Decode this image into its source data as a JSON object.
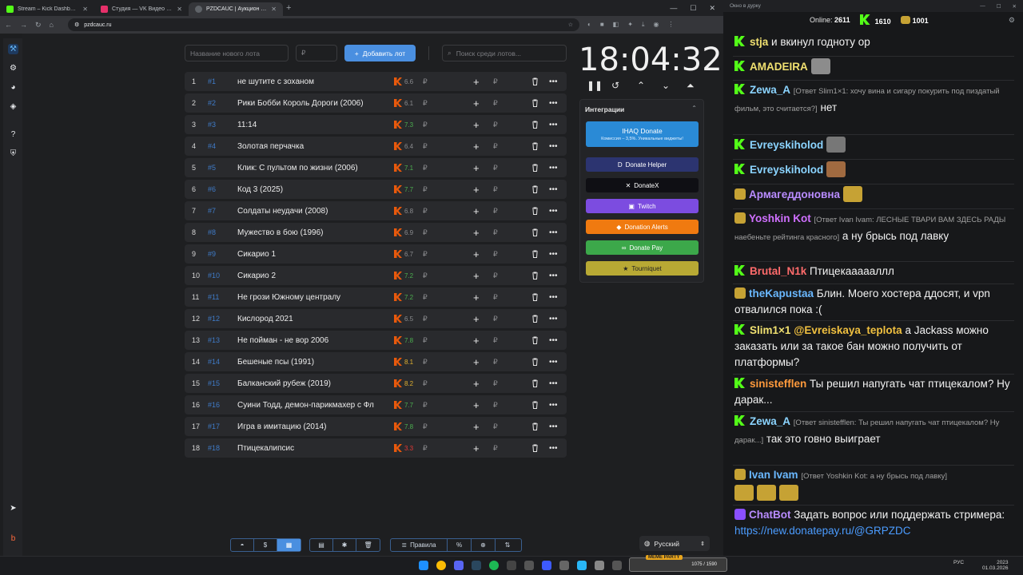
{
  "browser": {
    "tabs": [
      {
        "title": "Stream – Kick Dashboard",
        "color": "#53fc18"
      },
      {
        "title": "Студия — VK Видео Live",
        "color": "#e6306a"
      },
      {
        "title": "PZDCAUC | Аукцион для стри...",
        "color": "#9aa0a6"
      }
    ],
    "url": "pzdcauc.ru"
  },
  "lot_form": {
    "name_placeholder": "Название нового лота",
    "price_placeholder": "₽",
    "add_label": "Добавить лот",
    "search_placeholder": "Поиск среди лотов..."
  },
  "lots": [
    {
      "n": "1",
      "id": "#1",
      "title": "не шутите с зоханом",
      "kp": "6.6",
      "kp_color": "#8a8b8e"
    },
    {
      "n": "2",
      "id": "#2",
      "title": "Рики Бобби Король Дороги (2006)",
      "kp": "6.1",
      "kp_color": "#8a8b8e"
    },
    {
      "n": "3",
      "id": "#3",
      "title": "11:14",
      "kp": "7.3",
      "kp_color": "#4caf50"
    },
    {
      "n": "4",
      "id": "#4",
      "title": "Золотая перчачка",
      "kp": "6.4",
      "kp_color": "#8a8b8e"
    },
    {
      "n": "5",
      "id": "#5",
      "title": "Клик: С пультом по жизни (2006)",
      "kp": "7.1",
      "kp_color": "#4caf50"
    },
    {
      "n": "6",
      "id": "#6",
      "title": "Код 3 (2025)",
      "kp": "7.7",
      "kp_color": "#4caf50"
    },
    {
      "n": "7",
      "id": "#7",
      "title": "Солдаты неудачи (2008)",
      "kp": "6.8",
      "kp_color": "#8a8b8e"
    },
    {
      "n": "8",
      "id": "#8",
      "title": "Мужество в бою (1996)",
      "kp": "6.9",
      "kp_color": "#8a8b8e"
    },
    {
      "n": "9",
      "id": "#9",
      "title": "Сикарио 1",
      "kp": "6.7",
      "kp_color": "#8a8b8e"
    },
    {
      "n": "10",
      "id": "#10",
      "title": "Сикарио 2",
      "kp": "7.2",
      "kp_color": "#4caf50"
    },
    {
      "n": "11",
      "id": "#11",
      "title": "Не грози Южному централу",
      "kp": "7.2",
      "kp_color": "#4caf50"
    },
    {
      "n": "12",
      "id": "#12",
      "title": "Кислород 2021",
      "kp": "6.5",
      "kp_color": "#8a8b8e"
    },
    {
      "n": "13",
      "id": "#13",
      "title": "Не пойман - не вор 2006",
      "kp": "7.8",
      "kp_color": "#4caf50"
    },
    {
      "n": "14",
      "id": "#14",
      "title": "Бешеные псы (1991)",
      "kp": "8.1",
      "kp_color": "#e0b030"
    },
    {
      "n": "15",
      "id": "#15",
      "title": "Балканский рубеж (2019)",
      "kp": "8.2",
      "kp_color": "#e0b030"
    },
    {
      "n": "16",
      "id": "#16",
      "title": "Суини Тодд, демон-парикмахер с Фл",
      "kp": "7.7",
      "kp_color": "#4caf50"
    },
    {
      "n": "17",
      "id": "#17",
      "title": "Игра в имитацию (2014)",
      "kp": "7.8",
      "kp_color": "#4caf50"
    },
    {
      "n": "18",
      "id": "#18",
      "title": "Птицекалипсис",
      "kp": "3.3",
      "kp_color": "#e53935"
    }
  ],
  "currency": "₽",
  "timer": "18:04:32",
  "integrations": {
    "title": "Интеграции",
    "ihaq_title": "IHAQ Donate",
    "ihaq_sub": "Комиссия – 3,5%. Уникальные виджеты!",
    "buttons": [
      {
        "label": "Donate Helper",
        "bg": "#2c3470",
        "icon": "D"
      },
      {
        "label": "DonateX",
        "bg": "#0f0f14",
        "icon": "✕"
      },
      {
        "label": "Twitch",
        "bg": "#7c4ce0",
        "icon": "▣"
      },
      {
        "label": "Donation Alerts",
        "bg": "#f07a10",
        "icon": "◆"
      },
      {
        "label": "Donate Pay",
        "bg": "#3ca84a",
        "icon": "∞"
      },
      {
        "label": "Tourniquet",
        "bg": "#b8a934",
        "icon": "★"
      }
    ]
  },
  "toolbar": {
    "rules": "Правила",
    "percent": "%"
  },
  "language": "Русский",
  "chat": {
    "window_title": "Окно в дурку",
    "online_label": "Online:",
    "online": "2611",
    "kick_count": "1610",
    "vk_count": "1001",
    "messages": [
      {
        "user": "stja",
        "color": "#f0e070",
        "text": "и вкинул годноту ор"
      },
      {
        "user": "AMADEIRA",
        "color": "#f0e070",
        "text": ""
      },
      {
        "user": "Zewa_A",
        "color": "#8bd4ff",
        "reply": "[Ответ Slim1×1: хочу вина и сигару покурить под пиздатый фильм, это считается?]",
        "text": "нет"
      },
      {
        "user": "Evreyskiholod",
        "color": "#8bd4ff",
        "text": ""
      },
      {
        "user": "Evreyskiholod",
        "color": "#8bd4ff",
        "text": ""
      },
      {
        "user": "Армагеддоновна",
        "color": "#b98cff",
        "text": ""
      },
      {
        "user": "Yoshkin Kot",
        "color": "#d070ff",
        "reply": "[Ответ Ivan Ivam: ЛЕСНЫЕ ТВАРИ ВАМ ЗДЕСЬ РАДЫ наебеньте рейтинга красного]",
        "text": "а ну брысь под лавку"
      },
      {
        "user": "Brutal_N1k",
        "color": "#ff6b6b",
        "text": "Птицекаааааллл"
      },
      {
        "user": "theKapustaa",
        "color": "#6ab8ff",
        "text": "Блин. Моего хостера ддосят, и vpn отвалился пока :("
      },
      {
        "user": "Slim1×1",
        "color": "#f0e070",
        "mention": "@Evreiskaya_teplota",
        "text": "а Jackass можно заказать или за такое бан можно получить от платформы?"
      },
      {
        "user": "sinistefflen",
        "color": "#ff9a3c",
        "text": "Ты решил напугать чат птицекалом? Ну дарак..."
      },
      {
        "user": "Zewa_A",
        "color": "#8bd4ff",
        "reply": "[Ответ sinistefflen: Ты решил напугать чат птицекалом? Ну дарак...]",
        "text": "так это говно выиграет"
      },
      {
        "user": "Ivan Ivam",
        "color": "#6ab8ff",
        "reply": "[Ответ Yoshkin Kot: а ну брысь под лавку]",
        "text": ""
      },
      {
        "user": "ChatBot",
        "color": "#b98cff",
        "text": "Задать вопрос или поддержать стримера:",
        "link": "https://new.donatepay.ru/@GRPZDC"
      }
    ]
  },
  "taskbar": {
    "meme_party": "MEME PARTY",
    "meme_count": "1075 / 1590",
    "lang": "РУС",
    "time": "2023",
    "date": "01.03.2026"
  }
}
